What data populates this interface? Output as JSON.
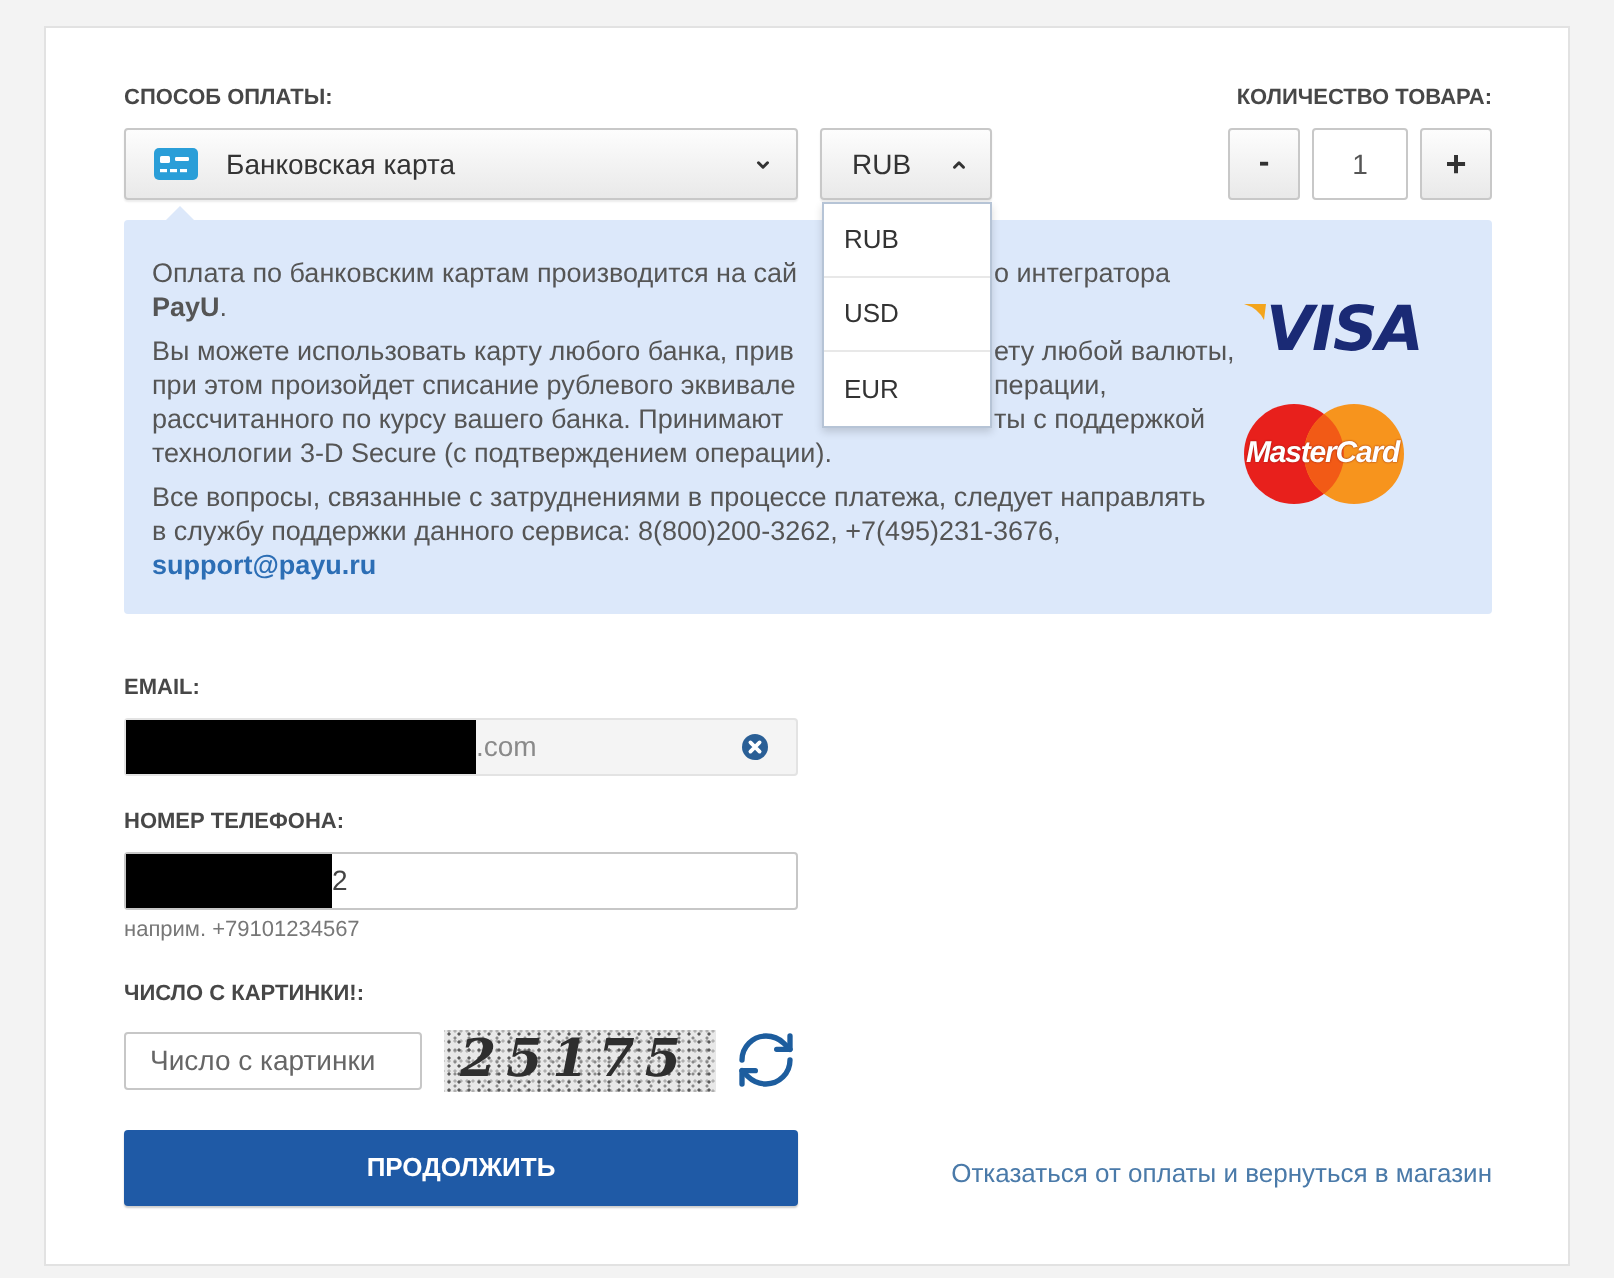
{
  "payment": {
    "label": "СПОСОБ ОПЛАТЫ:",
    "method": {
      "value": "Банковская карта",
      "expanded": false
    },
    "currency": {
      "value": "RUB",
      "expanded": true,
      "options": [
        "RUB",
        "USD",
        "EUR"
      ]
    }
  },
  "quantity": {
    "label": "КОЛИЧЕСТВО ТОВАРА:",
    "decrement": "-",
    "value": "1",
    "increment": "+"
  },
  "info": {
    "paragraphs": [
      {
        "lines": [
          {
            "text": "Оплата по банковским картам производится на сай",
            "after_cover": "о интегратора"
          },
          {
            "text": "**PayU**."
          }
        ]
      },
      {
        "lines": [
          {
            "text": "Вы можете использовать карту любого банка, прив",
            "after_cover": "ету любой валюты,"
          },
          {
            "text": "при этом произойдет списание рублевого эквивале",
            "after_cover": "перации,"
          },
          {
            "text": "рассчитанного по курсу вашего банка. Принимают",
            "after_cover": "ты с поддержкой"
          },
          {
            "text": "технологии 3-D Secure (с подтверждением операции)."
          }
        ]
      },
      {
        "text": "Все вопросы, связанные с затруднениями в процессе платежа, следует направлять в службу поддержки данного сервиса: 8(800)200-3262, +7(495)231-3676,",
        "link": "support@payu.ru"
      }
    ],
    "logos": [
      {
        "kind": "visa",
        "text": "VISA"
      },
      {
        "kind": "mastercard",
        "text": "MasterCard"
      }
    ]
  },
  "fields": [
    {
      "kind": "email",
      "label": "EMAIL:",
      "value": ".com",
      "redacted": true,
      "readonly": true,
      "clear_button": true
    },
    {
      "kind": "phone",
      "label": "НОМЕР ТЕЛЕФОНА:",
      "value": "2",
      "redacted": true,
      "readonly": false,
      "hint": "наприм. +79101234567"
    },
    {
      "kind": "captcha",
      "label": "ЧИСЛО С КАРТИНКИ!:",
      "placeholder": "Число с картинки",
      "code": "25175"
    }
  ],
  "actions": {
    "submit": "ПРОДОЛЖИТЬ",
    "cancel": "Отказаться от оплаты и вернуться в магазин"
  }
}
